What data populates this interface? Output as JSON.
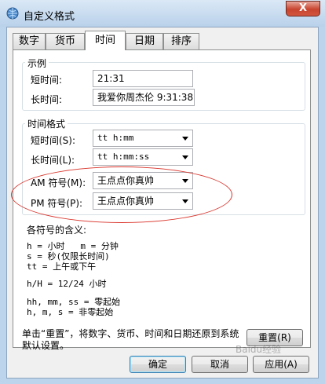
{
  "window": {
    "title": "自定义格式",
    "close_label": "X"
  },
  "tabs": [
    {
      "label": "数字"
    },
    {
      "label": "货币"
    },
    {
      "label": "时间"
    },
    {
      "label": "日期"
    },
    {
      "label": "排序"
    }
  ],
  "sample": {
    "group_title": "示例",
    "short_label": "短时间:",
    "short_value": "21:31",
    "long_label": "长时间:",
    "long_value": "我爱你周杰伦 9:31:38"
  },
  "time_formats": {
    "group_title": "时间格式",
    "short_label": "短时间(S):",
    "short_value": "tt h:mm",
    "long_label": "长时间(L):",
    "long_value": "tt h:mm:ss",
    "am_label": "AM 符号(M):",
    "am_value": "王点点你真帅",
    "pm_label": "PM 符号(P):",
    "pm_value": "王点点你真帅"
  },
  "legend": {
    "title": "各符号的含义:",
    "lines": [
      "h = 小时   m = 分钟",
      "s = 秒(仅限长时间)",
      "tt = 上午或下午",
      "h/H = 12/24 小时",
      "hh, mm, ss = 零起始",
      "h, m, s = 非零起始"
    ]
  },
  "footer": {
    "reset_note": "单击“重置”，将数字、货币、时间和日期还原到系统默认设置。",
    "reset_button": "重置(R)",
    "ok_button": "确定",
    "cancel_button": "取消",
    "apply_button": "应用(A)"
  },
  "watermark": "Baidu经验",
  "colors": {
    "annotation_ellipse": "#d9332a"
  }
}
